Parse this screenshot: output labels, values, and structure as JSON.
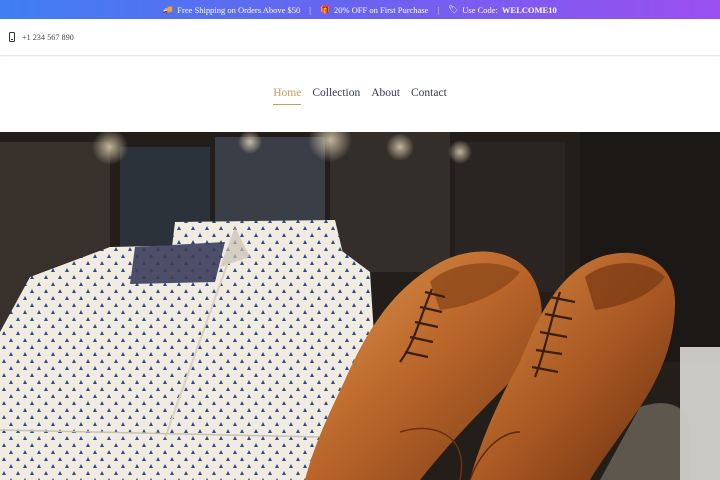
{
  "promo": {
    "items": [
      {
        "icon": "truck-icon",
        "text": "Free Shipping on Orders Above $50"
      },
      {
        "icon": "gift-icon",
        "text": "20% OFF on First Purchase"
      },
      {
        "icon": "tag-icon",
        "prefix": "Use Code: ",
        "code": "WELCOME10"
      }
    ],
    "separator": "|"
  },
  "contact": {
    "icon": "phone-icon",
    "phone": "+1 234 567 890"
  },
  "nav": {
    "items": [
      {
        "label": "Home",
        "active": true
      },
      {
        "label": "Collection",
        "active": false
      },
      {
        "label": "About",
        "active": false
      },
      {
        "label": "Contact",
        "active": false
      }
    ],
    "accent_color": "#c79a5d",
    "text_color": "#2f3a55"
  },
  "hero": {
    "image": "folded-shirts-and-brown-leather-shoes",
    "colors": {
      "leather": "#b9652a",
      "shirt": "#f1ece2",
      "dots": "#2d4a8a"
    }
  }
}
